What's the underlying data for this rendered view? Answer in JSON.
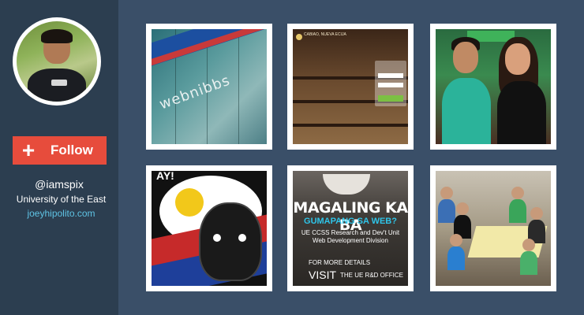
{
  "profile": {
    "avatar_icon": "profile-photo",
    "follow_label": "Follow",
    "follow_icon": "plus-icon",
    "follow_color": "#e74c3c",
    "handle": "@iamspix",
    "school": "University of the East",
    "website": "joeyhipolito.com",
    "link_color": "#5fc3e4"
  },
  "tiles": [
    {
      "label": "webnibbs building sign",
      "sign_text": "webnibbs"
    },
    {
      "label": "library login page",
      "header_text": "CABIAO, NUEVA ECIJA"
    },
    {
      "label": "two people photo"
    },
    {
      "label": "cartoon bull poster",
      "text": "AY!"
    },
    {
      "label": "magaling ka ba poster",
      "headline": "MAGALING KA BA",
      "subheadline": "GUMAPANG SA WEB?",
      "line1": "UE CCSS Research and Dev't Unit",
      "line2": "Web Development Division",
      "line3": "FOR MORE DETAILS",
      "line4": "VISIT",
      "line5": "THE UE R&D OFFICE"
    },
    {
      "label": "group dinner photo"
    }
  ],
  "colors": {
    "background": "#3a4f68",
    "sidebar": "#2c3e50"
  }
}
